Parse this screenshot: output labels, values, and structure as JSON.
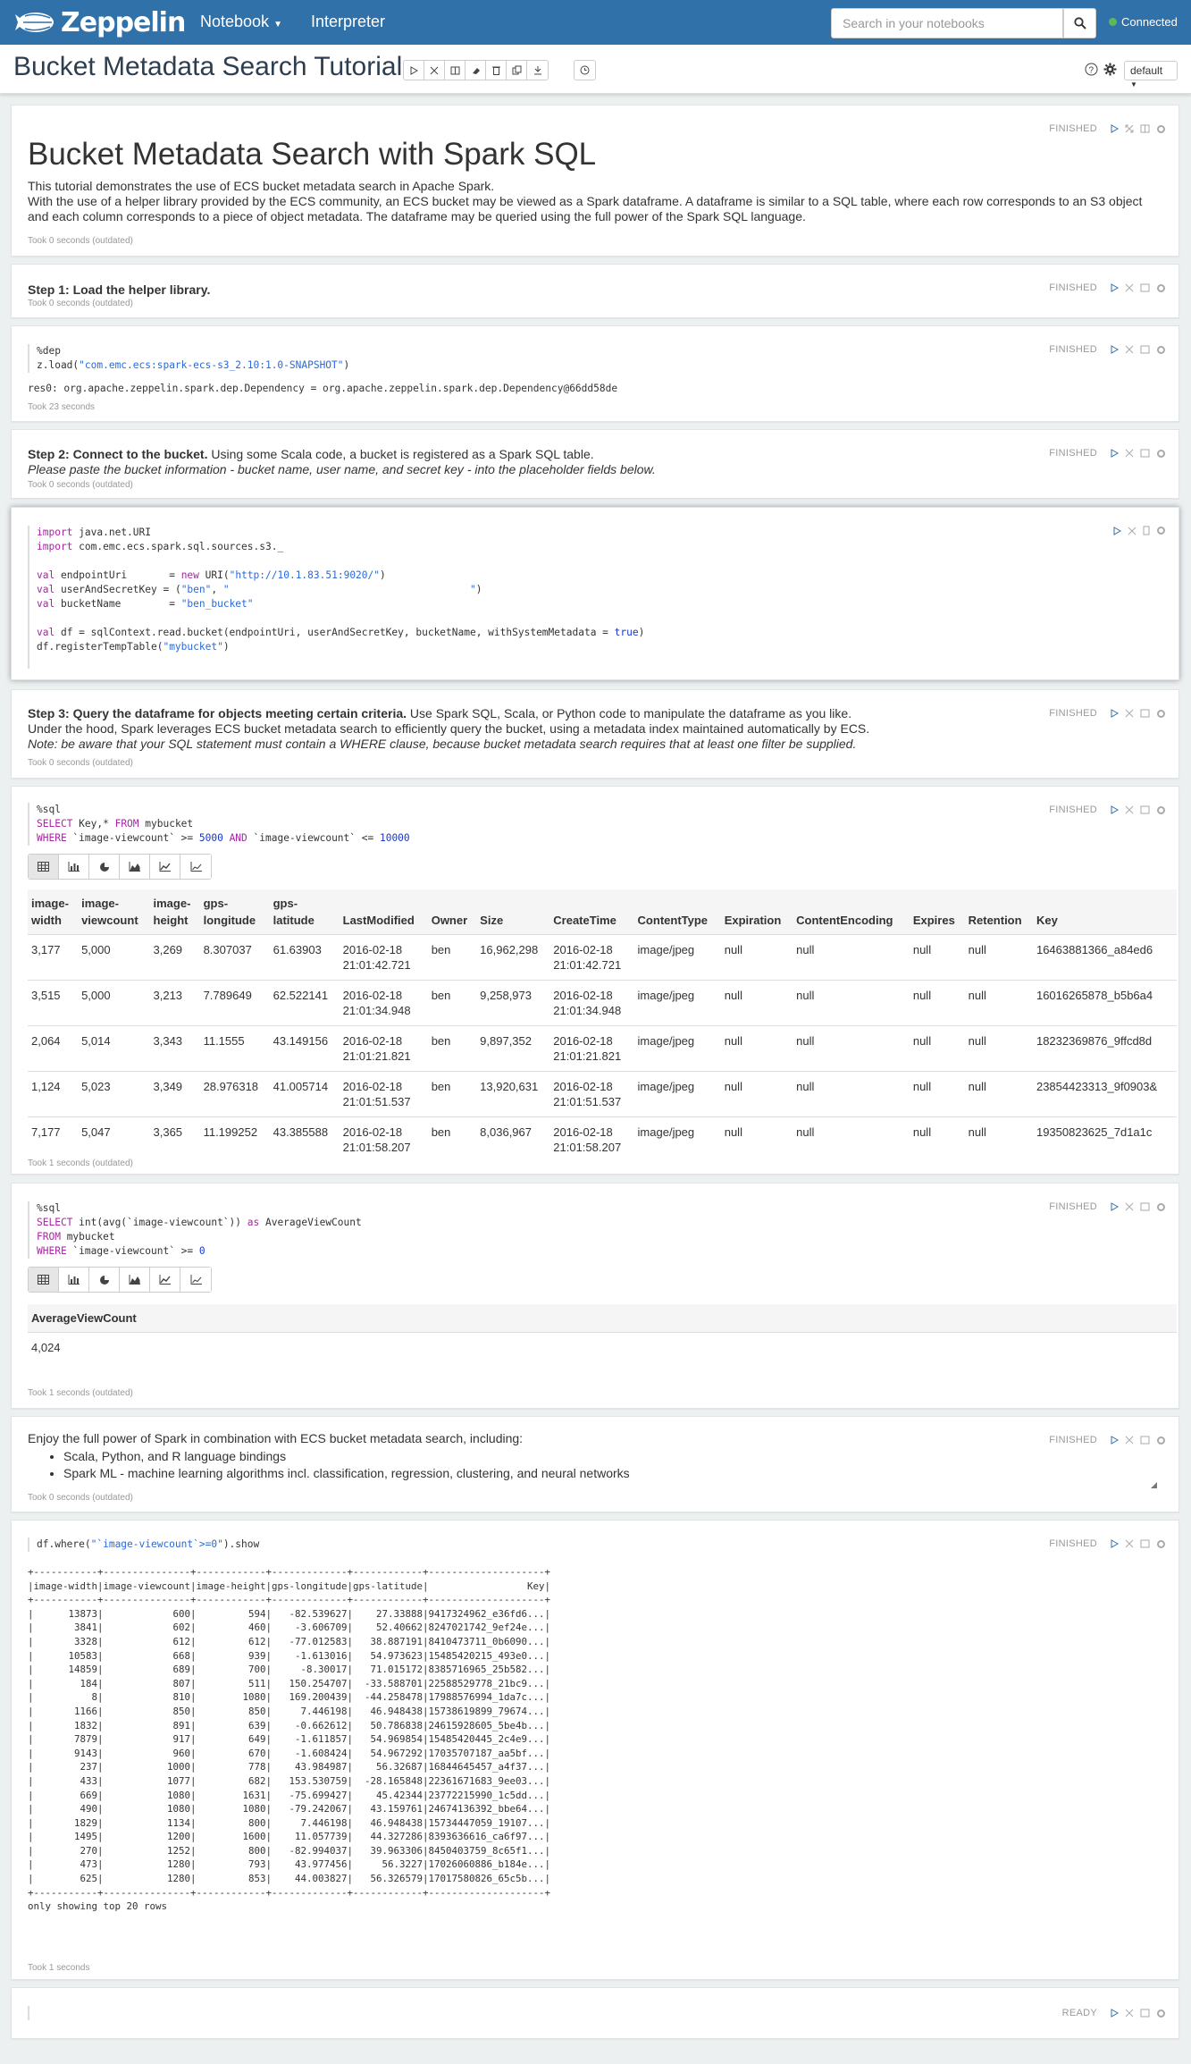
{
  "nav": {
    "brand": "Zeppelin",
    "notebook": "Notebook",
    "interpreter": "Interpreter",
    "search_placeholder": "Search in your notebooks",
    "status": "Connected"
  },
  "header": {
    "title": "Bucket Metadata Search Tutorial",
    "interpreter_default": "default"
  },
  "p1": {
    "status": "FINISHED",
    "heading": "Bucket Metadata Search with Spark SQL",
    "line1": "This tutorial demonstrates the use of ECS bucket metadata search in Apache Spark.",
    "line2": "With the use of a helper library provided by the ECS community, an ECS bucket may be viewed as a Spark dataframe. A dataframe is similar to a SQL table, where each row corresponds to an S3 object",
    "line3": "and each column corresponds to a piece of object metadata. The dataframe may be queried using the full power of the Spark SQL language.",
    "took": "Took 0 seconds (outdated)"
  },
  "p2": {
    "status": "FINISHED",
    "text": "Step 1: Load the helper library.",
    "took": "Took 0 seconds (outdated)"
  },
  "p3": {
    "status": "FINISHED",
    "code1": "%dep",
    "code2a": "z.load(",
    "code2b": "\"com.emc.ecs:spark-ecs-s3_2.10:1.0-SNAPSHOT\"",
    "code2c": ")",
    "output": "res0: org.apache.zeppelin.spark.dep.Dependency = org.apache.zeppelin.spark.dep.Dependency@66dd58de",
    "took": "Took 23 seconds"
  },
  "p4": {
    "status": "FINISHED",
    "bold": "Step 2: Connect to the bucket.",
    "rest": " Using some Scala code, a bucket is registered as a Spark SQL table.",
    "italic": "Please paste the bucket information - bucket name, user name, and secret key - into the placeholder fields below.",
    "took": "Took 0 seconds (outdated)"
  },
  "p5": {
    "l1": "java.net.URI",
    "l2": "com.emc.ecs.spark.sql.sources.s3._",
    "l4a": "endpointUri       = ",
    "l4b": "URI(",
    "l4c": "\"http://10.1.83.51:9020/\"",
    "l4d": ")",
    "l5a": "userAndSecretKey = (",
    "l5b": "\"ben\"",
    "l5c": ", ",
    "l5d": "\"                                        \"",
    "l5e": ")",
    "l6a": "bucketName        = ",
    "l6b": "\"ben_bucket\"",
    "l8a": "df = sqlContext.read.bucket(endpointUri, userAndSecretKey, bucketName, withSystemMetadata = ",
    "l8b": "true",
    "l8c": ")",
    "l9a": "df.registerTempTable(",
    "l9b": "\"mybucket\"",
    "l9c": ")",
    "kw_import": "import",
    "kw_val": "val",
    "kw_new": "new"
  },
  "p6": {
    "status": "FINISHED",
    "bold": "Step 3: Query the dataframe for objects meeting certain criteria.",
    "rest": " Use Spark SQL, Scala, or Python code to manipulate the dataframe as you like.",
    "line2": "Under the hood, Spark leverages ECS bucket metadata search to efficiently query the bucket, using a metadata index maintained automatically by ECS.",
    "italic": "Note: be aware that your SQL statement must contain a WHERE clause, because bucket metadata search requires that at least one filter be supplied.",
    "took": "Took 0 seconds (outdated)"
  },
  "p7": {
    "status": "FINISHED",
    "c1": "%sql",
    "c2a": "SELECT",
    "c2b": " Key,* ",
    "c2c": "FROM",
    "c2d": " mybucket",
    "c3a": "WHERE",
    "c3b": " `image-viewcount` >= ",
    "c3c": "5000",
    "c3d": " AND ",
    "c3e": "`image-viewcount` <= ",
    "c3f": "10000",
    "headers": [
      "image-\nwidth",
      "image-\nviewcount",
      "image-\nheight",
      "gps-\nlongitude",
      "gps-\nlatitude",
      "LastModified",
      "Owner",
      "Size",
      "CreateTime",
      "ContentType",
      "Expiration",
      "ContentEncoding",
      "Expires",
      "Retention",
      "Key"
    ],
    "rows": [
      [
        "3,177",
        "5,000",
        "3,269",
        "8.307037",
        "61.63903",
        "2016-02-18\n21:01:42.721",
        "ben",
        "16,962,298",
        "2016-02-18\n21:01:42.721",
        "image/jpeg",
        "null",
        "null",
        "null",
        "null",
        "16463881366_a84ed6"
      ],
      [
        "3,515",
        "5,000",
        "3,213",
        "7.789649",
        "62.522141",
        "2016-02-18\n21:01:34.948",
        "ben",
        "9,258,973",
        "2016-02-18\n21:01:34.948",
        "image/jpeg",
        "null",
        "null",
        "null",
        "null",
        "16016265878_b5b6a4"
      ],
      [
        "2,064",
        "5,014",
        "3,343",
        "11.1555",
        "43.149156",
        "2016-02-18\n21:01:21.821",
        "ben",
        "9,897,352",
        "2016-02-18\n21:01:21.821",
        "image/jpeg",
        "null",
        "null",
        "null",
        "null",
        "18232369876_9ffcd8d"
      ],
      [
        "1,124",
        "5,023",
        "3,349",
        "28.976318",
        "41.005714",
        "2016-02-18\n21:01:51.537",
        "ben",
        "13,920,631",
        "2016-02-18\n21:01:51.537",
        "image/jpeg",
        "null",
        "null",
        "null",
        "null",
        "23854423313_9f0903&"
      ],
      [
        "7,177",
        "5,047",
        "3,365",
        "11.199252",
        "43.385588",
        "2016-02-18\n21:01:58.207",
        "ben",
        "8,036,967",
        "2016-02-18\n21:01:58.207",
        "image/jpeg",
        "null",
        "null",
        "null",
        "null",
        "19350823625_7d1a1c"
      ]
    ],
    "took": "Took 1 seconds (outdated)"
  },
  "p8": {
    "status": "FINISHED",
    "c1": "%sql",
    "c2a": "SELECT",
    "c2b": " int(avg(`image-viewcount`)) ",
    "c2c": "as",
    "c2d": " AverageViewCount",
    "c3a": "FROM",
    "c3b": " mybucket",
    "c4a": "WHERE",
    "c4b": " `image-viewcount` >= ",
    "c4c": "0",
    "header": "AverageViewCount",
    "value": "4,024",
    "took": "Took 1 seconds (outdated)"
  },
  "p9": {
    "status": "FINISHED",
    "intro": "Enjoy the full power of Spark in combination with ECS bucket metadata search, including:",
    "b1": "Scala, Python, and R language bindings",
    "b2": "Spark ML - machine learning algorithms incl. classification, regression, clustering, and neural networks",
    "took": "Took 0 seconds (outdated)"
  },
  "p10": {
    "status": "FINISHED",
    "code_a": "df.where(",
    "code_b": "\"`image-viewcount`>=0\"",
    "code_c": ").show",
    "output": "+-----------+---------------+------------+-------------+------------+--------------------+\n|image-width|image-viewcount|image-height|gps-longitude|gps-latitude|                 Key|\n+-----------+---------------+------------+-------------+------------+--------------------+\n|      13873|            600|         594|   -82.539627|    27.33888|9417324962_e36fd6...|\n|       3841|            602|         460|    -3.606709|    52.40662|8247021742_9ef24e...|\n|       3328|            612|         612|   -77.012583|   38.887191|8410473711_0b6090...|\n|      10583|            668|         939|    -1.613016|   54.973623|15485420215_493e0...|\n|      14859|            689|         700|     -8.30017|   71.015172|8385716965_25b582...|\n|        184|            807|         511|   150.254707|  -33.588701|22588529778_21bc9...|\n|          8|            810|        1080|   169.200439|  -44.258478|17988576994_1da7c...|\n|       1166|            850|         850|     7.446198|   46.948438|15738619899_79674...|\n|       1832|            891|         639|    -0.662612|   50.786838|24615928605_5be4b...|\n|       7879|            917|         649|    -1.611857|   54.969854|15485420445_2c4e9...|\n|       9143|            960|         670|    -1.608424|   54.967292|17035707187_aa5bf...|\n|        237|           1000|         778|    43.984987|    56.32687|16844645457_a4f37...|\n|        433|           1077|         682|   153.530759|  -28.165848|22361671683_9ee03...|\n|        669|           1080|        1631|   -75.699427|    45.42344|23772215990_1c5dd...|\n|        490|           1080|        1080|   -79.242067|   43.159761|24674136392_bbe64...|\n|       1829|           1134|         800|     7.446198|   46.948438|15734447059_19107...|\n|       1495|           1200|        1600|    11.057739|   44.327286|8393636616_ca6f97...|\n|        270|           1252|         800|   -82.994037|   39.963306|8450403759_8c65f1...|\n|        473|           1280|         793|    43.977456|     56.3227|17026060886_b184e...|\n|        625|           1280|         853|    44.003827|   56.326579|17017580826_65c5b...|\n+-----------+---------------+------------+-------------+------------+--------------------+\nonly showing top 20 rows",
    "took": "Took 1 seconds"
  },
  "p11": {
    "status": "READY"
  }
}
